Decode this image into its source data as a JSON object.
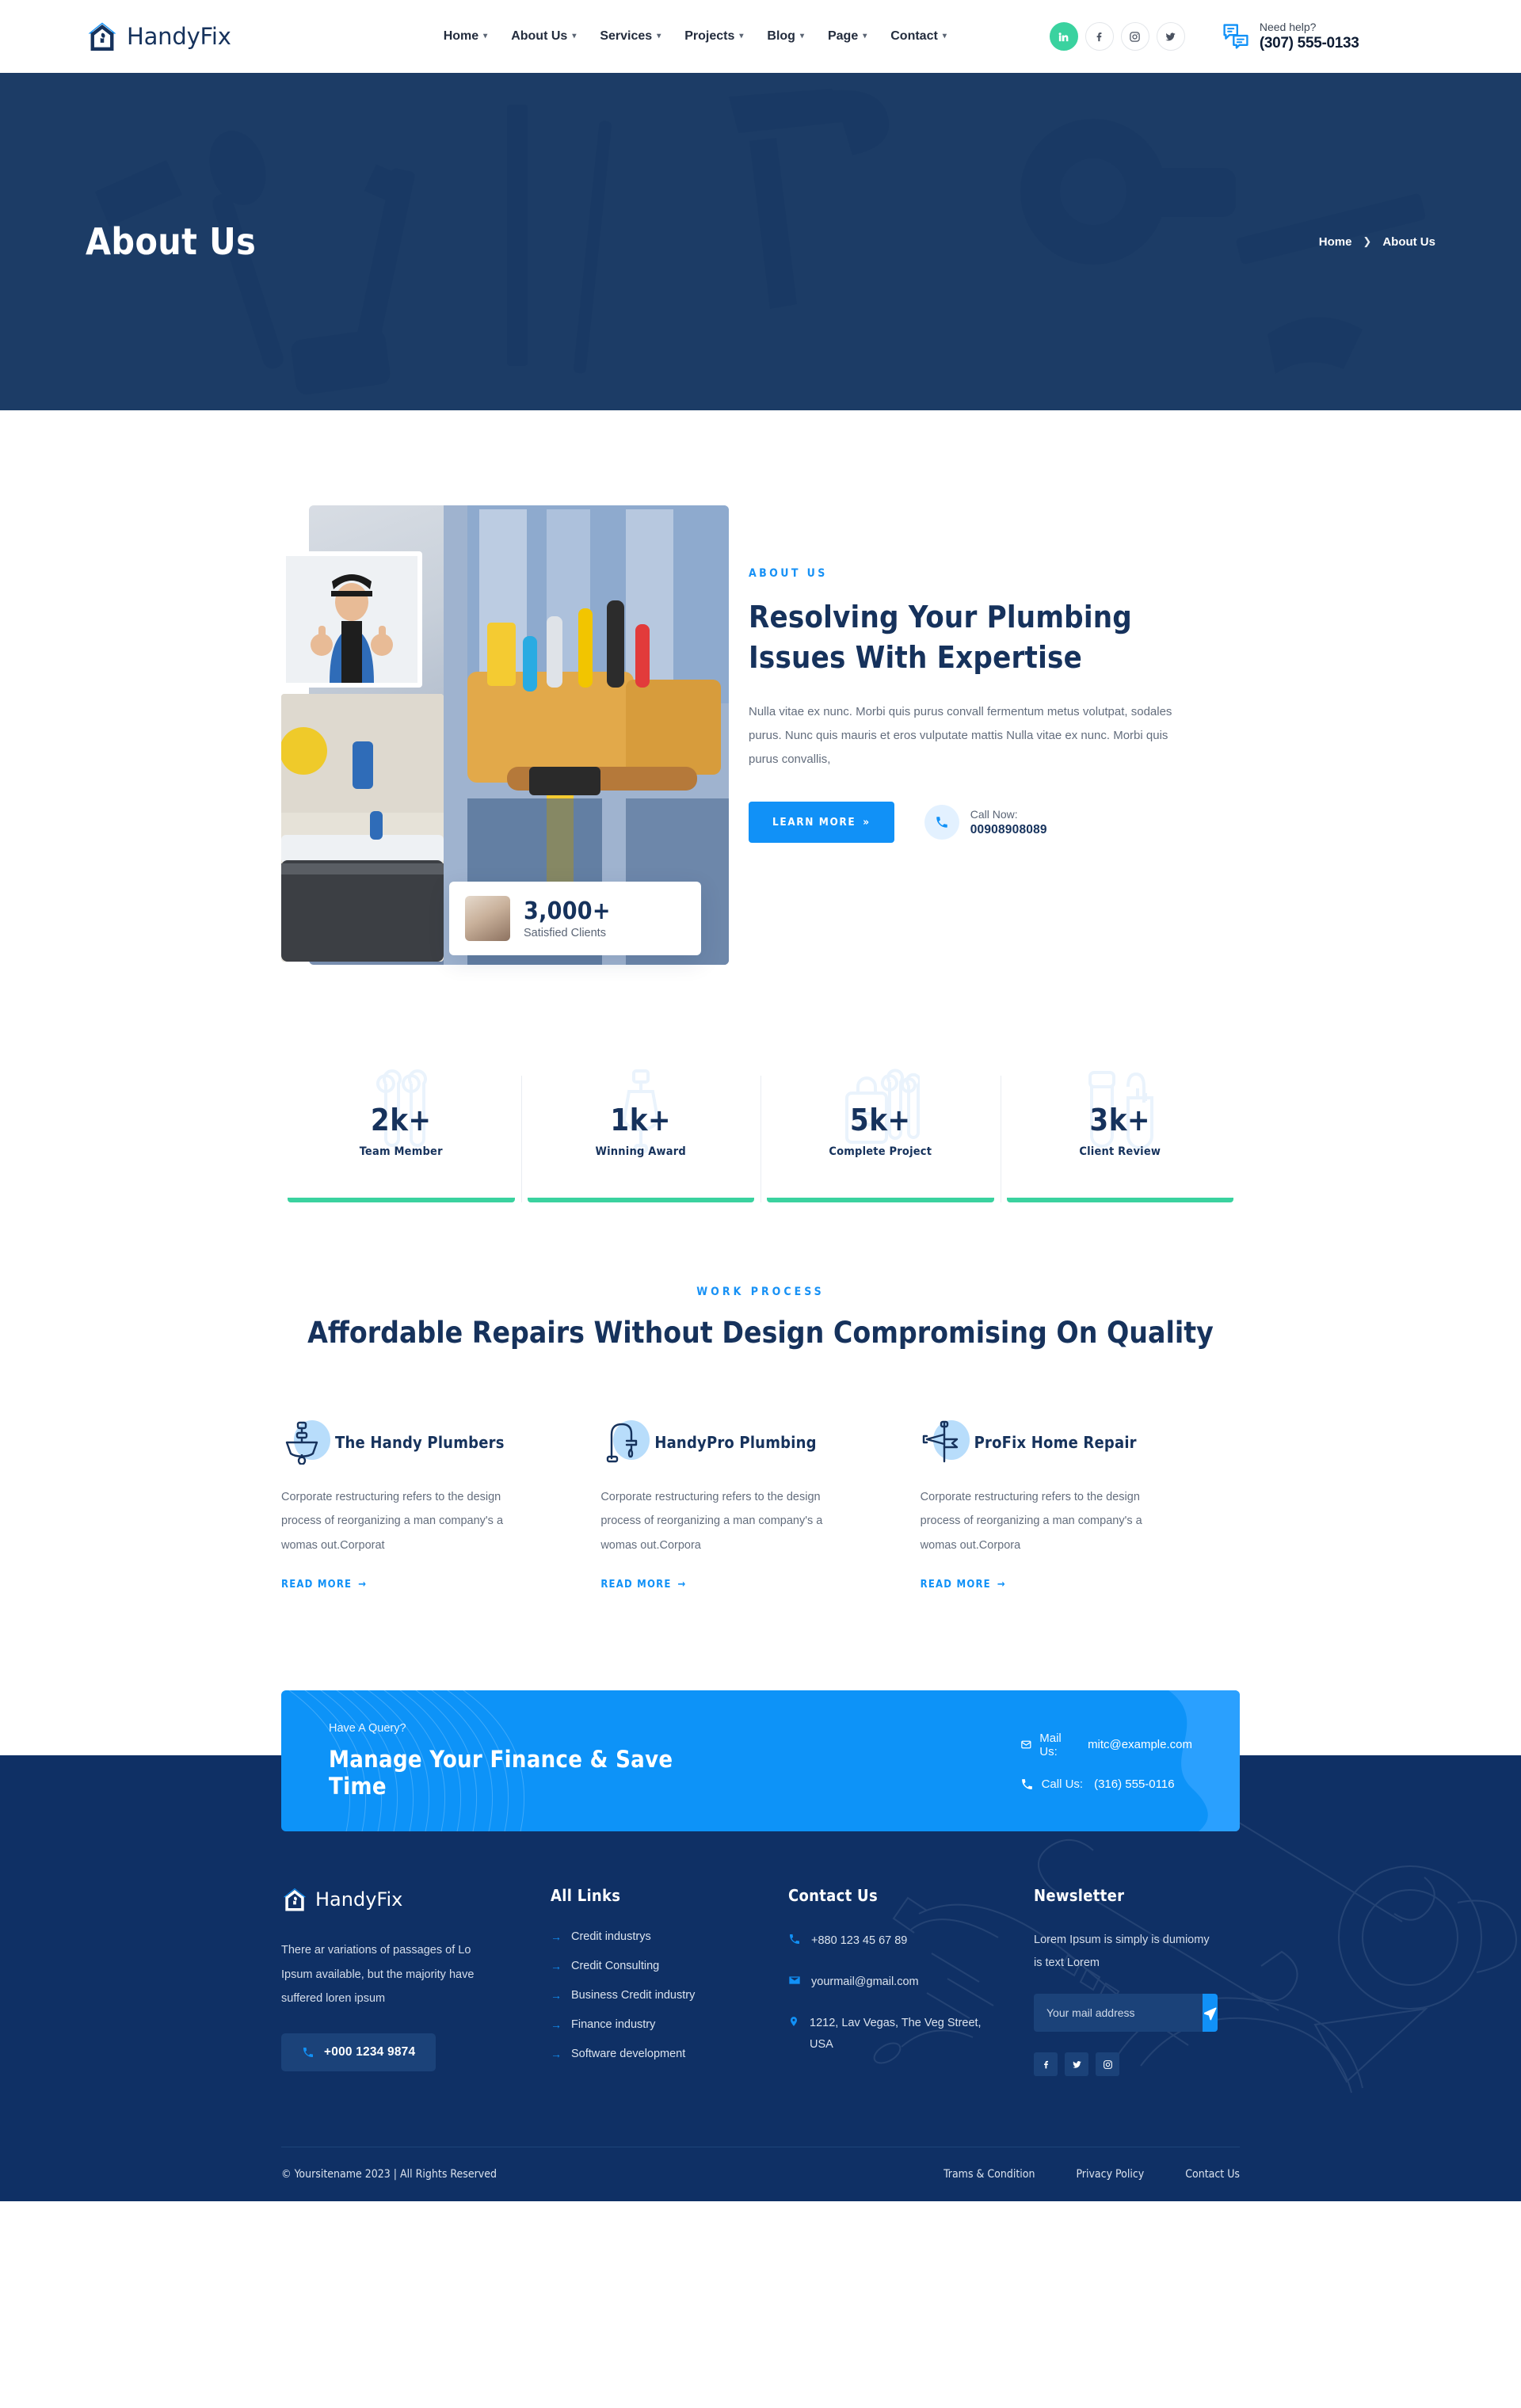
{
  "brand": {
    "name": "HandyFix",
    "accent": "#1191f7",
    "dark": "#16325c",
    "green": "#3ad29f"
  },
  "header": {
    "nav": [
      {
        "label": "Home",
        "caret": "chevron-down"
      },
      {
        "label": "About Us",
        "caret": "chevron-down"
      },
      {
        "label": "Services",
        "caret": "chevron-down"
      },
      {
        "label": "Projects",
        "caret": "chevron-down"
      },
      {
        "label": "Blog",
        "caret": "chevron-down"
      },
      {
        "label": "Page",
        "caret": "chevron-down"
      },
      {
        "label": "Contact",
        "caret": "chevron-down"
      }
    ],
    "socials": [
      {
        "icon": "linkedin-icon",
        "glyph": "in",
        "accent": true
      },
      {
        "icon": "facebook-icon",
        "glyph": "f",
        "accent": false
      },
      {
        "icon": "instagram-icon",
        "glyph": "◎",
        "accent": false
      },
      {
        "icon": "twitter-icon",
        "glyph": "🐦",
        "accent": false
      }
    ],
    "help_label": "Need help?",
    "help_phone": "(307) 555-0133"
  },
  "hero": {
    "title": "About Us",
    "breadcrumb": [
      "Home",
      "About Us"
    ],
    "separator": "❯"
  },
  "about": {
    "eyebrow": "ABOUT US",
    "heading": "Resolving Your Plumbing Issues With Expertise",
    "paragraph": "Nulla vitae ex nunc. Morbi quis purus convall fermentum metus volutpat, sodales purus. Nunc quis mauris et eros vulputate mattis Nulla vitae ex nunc. Morbi quis purus convallis,",
    "button": "LEARN MORE",
    "button_arrow": "»",
    "call_label": "Call Now:",
    "call_number": "00908908089",
    "clients_number": "3,000+",
    "clients_label": "Satisfied Clients"
  },
  "counters": [
    {
      "number": "2k+",
      "label": "Team Member",
      "icon": "wrench-icon"
    },
    {
      "number": "1k+",
      "label": "Winning Award",
      "icon": "plunger-icon"
    },
    {
      "number": "5k+",
      "label": "Complete Project",
      "icon": "toolbox-icon"
    },
    {
      "number": "3k+",
      "label": "Client Review",
      "icon": "gloves-icon"
    }
  ],
  "process": {
    "eyebrow": "WORK PROCESS",
    "heading": "Affordable Repairs Without Design Compromising On Quality",
    "cards": [
      {
        "icon": "sink-icon",
        "title": "The Handy Plumbers",
        "text": "Corporate restructuring refers to the design process of reorganizing a man company's a womas out.Corporat",
        "link": "READ MORE",
        "link_arrow": "→"
      },
      {
        "icon": "faucet-icon",
        "title": "HandyPro Plumbing",
        "text": "Corporate restructuring refers to the design process of reorganizing a man company's a womas out.Corpora",
        "link": "READ MORE",
        "link_arrow": "→"
      },
      {
        "icon": "pipe-wrench-icon",
        "title": "ProFix Home Repair",
        "text": "Corporate restructuring refers to the design process of reorganizing a man company's a womas out.Corpora",
        "link": "READ MORE",
        "link_arrow": "→"
      }
    ]
  },
  "cta": {
    "small": "Have A Query?",
    "big": "Manage Your Finance & Save Time",
    "mail_label": "Mail Us:",
    "mail_value": "mitc@example.com",
    "call_label": "Call Us:",
    "call_value": "(316) 555-0116"
  },
  "footer": {
    "brand": "HandyFix",
    "description": "There ar variations of passages of Lo Ipsum available, but the majority have suffered loren ipsum",
    "phone_button": "+000 1234 9874",
    "links_title": "All Links",
    "links": [
      "Credit industrys",
      "Credit Consulting",
      "Business Credit industry",
      "Finance industry",
      "Software development"
    ],
    "link_arrow": "→",
    "contact_title": "Contact Us",
    "contact": [
      {
        "icon": "phone-icon",
        "text": "+880 123 45 67 89"
      },
      {
        "icon": "mail-icon",
        "text": "yourmail@gmail.com"
      },
      {
        "icon": "location-icon",
        "text": "1212, Lav Vegas, The Veg Street, USA"
      }
    ],
    "newsletter_title": "Newsletter",
    "newsletter_text": "Lorem Ipsum is simply is dumiomy is text Lorem",
    "newsletter_placeholder": "Your mail address",
    "newsletter_value": "",
    "send_icon": "send-icon",
    "socials": [
      {
        "icon": "facebook-icon",
        "glyph": "f"
      },
      {
        "icon": "twitter-icon",
        "glyph": "🐦"
      },
      {
        "icon": "instagram-icon",
        "glyph": "◎"
      }
    ],
    "copyright": "© Yoursitename  2023 | All Rights Reserved",
    "bottom_links": [
      "Trams & Condition",
      "Privacy Policy",
      "Contact Us"
    ]
  }
}
